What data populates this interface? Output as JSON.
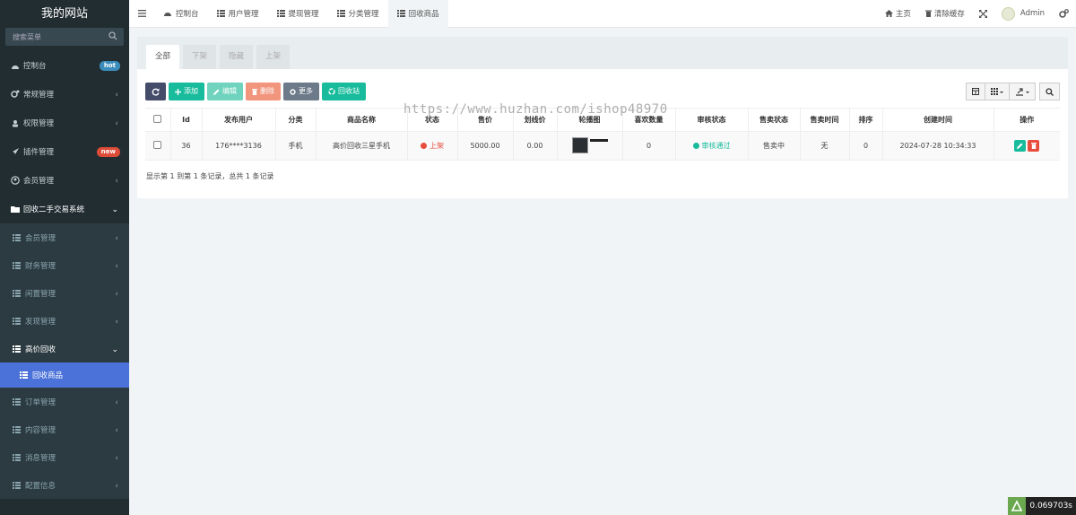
{
  "brand": "我的网站",
  "sidebar": {
    "search_placeholder": "搜索菜单",
    "items": [
      {
        "label": "控制台",
        "badge": "hot"
      },
      {
        "label": "常规管理"
      },
      {
        "label": "权限管理"
      },
      {
        "label": "插件管理",
        "badge": "new"
      },
      {
        "label": "会员管理"
      },
      {
        "label": "回收二手交易系统"
      }
    ],
    "sub_items": [
      {
        "label": "会员管理"
      },
      {
        "label": "财务管理"
      },
      {
        "label": "闲置管理"
      },
      {
        "label": "发现管理"
      },
      {
        "label": "高价回收"
      }
    ],
    "sub2_items": [
      {
        "label": "回收商品"
      }
    ],
    "sub_items_after": [
      {
        "label": "订单管理"
      },
      {
        "label": "内容管理"
      },
      {
        "label": "消息管理"
      },
      {
        "label": "配置信息"
      }
    ]
  },
  "topbar": {
    "tabs": [
      {
        "label": "控制台"
      },
      {
        "label": "用户管理"
      },
      {
        "label": "提现管理"
      },
      {
        "label": "分类管理"
      },
      {
        "label": "回收商品"
      }
    ],
    "home": "主页",
    "clear_cache": "清除缓存",
    "user": "Admin"
  },
  "panel": {
    "tabs": [
      "全部",
      "下架",
      "隐藏",
      "上架"
    ],
    "toolbar": {
      "add": "添加",
      "edit": "编辑",
      "delete": "删除",
      "more": "更多",
      "recycle": "回收站"
    },
    "columns": [
      "Id",
      "发布用户",
      "分类",
      "商品名称",
      "状态",
      "售价",
      "划线价",
      "轮播图",
      "喜欢数量",
      "审核状态",
      "售卖状态",
      "售卖时间",
      "排序",
      "创建时间",
      "操作"
    ],
    "rows": [
      {
        "id": "36",
        "user": "176****3136",
        "category": "手机",
        "name": "高价回收三星手机",
        "status": "上架",
        "price": "5000.00",
        "line_price": "0.00",
        "likes": "0",
        "audit": "审核通过",
        "sale_status": "售卖中",
        "sale_time": "无",
        "sort": "0",
        "created": "2024-07-28 10:34:33"
      }
    ],
    "pager": "显示第 1 到第 1 条记录，总共 1 条记录"
  },
  "watermark": "https://www.huzhan.com/ishop48970",
  "trace_time": "0.069703s",
  "colors": {
    "sidebar_bg": "#222d32",
    "active_menu": "#4b72d8",
    "primary_green": "#18bc9c",
    "danger_red": "#e74c3c"
  }
}
